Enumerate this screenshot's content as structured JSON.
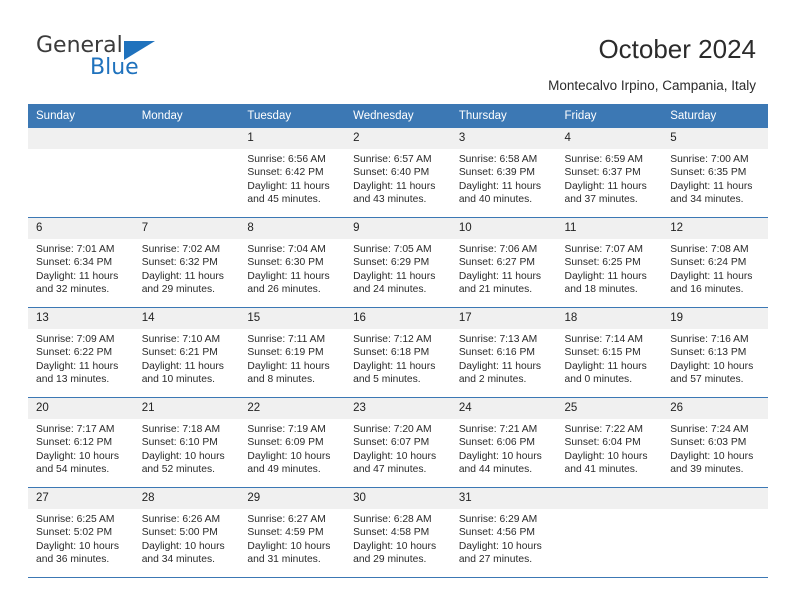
{
  "brand": {
    "word_one": "General",
    "word_two": "Blue",
    "triangle_icon": "blue-triangle-icon",
    "color_dark": "#3b3b3b",
    "color_blue": "#1f72bd"
  },
  "header": {
    "title": "October 2024",
    "subtitle": "Montecalvo Irpino, Campania, Italy"
  },
  "theme": {
    "header_bg": "#3c78b4",
    "header_text": "#ffffff",
    "daynum_bg": "#f0f0f0",
    "row_line": "#3c78b4"
  },
  "weekdays": [
    "Sunday",
    "Monday",
    "Tuesday",
    "Wednesday",
    "Thursday",
    "Friday",
    "Saturday"
  ],
  "weeks": [
    [
      {
        "day": "",
        "lines": []
      },
      {
        "day": "",
        "lines": []
      },
      {
        "day": "1",
        "lines": [
          "Sunrise: 6:56 AM",
          "Sunset: 6:42 PM",
          "Daylight: 11 hours",
          "and 45 minutes."
        ]
      },
      {
        "day": "2",
        "lines": [
          "Sunrise: 6:57 AM",
          "Sunset: 6:40 PM",
          "Daylight: 11 hours",
          "and 43 minutes."
        ]
      },
      {
        "day": "3",
        "lines": [
          "Sunrise: 6:58 AM",
          "Sunset: 6:39 PM",
          "Daylight: 11 hours",
          "and 40 minutes."
        ]
      },
      {
        "day": "4",
        "lines": [
          "Sunrise: 6:59 AM",
          "Sunset: 6:37 PM",
          "Daylight: 11 hours",
          "and 37 minutes."
        ]
      },
      {
        "day": "5",
        "lines": [
          "Sunrise: 7:00 AM",
          "Sunset: 6:35 PM",
          "Daylight: 11 hours",
          "and 34 minutes."
        ]
      }
    ],
    [
      {
        "day": "6",
        "lines": [
          "Sunrise: 7:01 AM",
          "Sunset: 6:34 PM",
          "Daylight: 11 hours",
          "and 32 minutes."
        ]
      },
      {
        "day": "7",
        "lines": [
          "Sunrise: 7:02 AM",
          "Sunset: 6:32 PM",
          "Daylight: 11 hours",
          "and 29 minutes."
        ]
      },
      {
        "day": "8",
        "lines": [
          "Sunrise: 7:04 AM",
          "Sunset: 6:30 PM",
          "Daylight: 11 hours",
          "and 26 minutes."
        ]
      },
      {
        "day": "9",
        "lines": [
          "Sunrise: 7:05 AM",
          "Sunset: 6:29 PM",
          "Daylight: 11 hours",
          "and 24 minutes."
        ]
      },
      {
        "day": "10",
        "lines": [
          "Sunrise: 7:06 AM",
          "Sunset: 6:27 PM",
          "Daylight: 11 hours",
          "and 21 minutes."
        ]
      },
      {
        "day": "11",
        "lines": [
          "Sunrise: 7:07 AM",
          "Sunset: 6:25 PM",
          "Daylight: 11 hours",
          "and 18 minutes."
        ]
      },
      {
        "day": "12",
        "lines": [
          "Sunrise: 7:08 AM",
          "Sunset: 6:24 PM",
          "Daylight: 11 hours",
          "and 16 minutes."
        ]
      }
    ],
    [
      {
        "day": "13",
        "lines": [
          "Sunrise: 7:09 AM",
          "Sunset: 6:22 PM",
          "Daylight: 11 hours",
          "and 13 minutes."
        ]
      },
      {
        "day": "14",
        "lines": [
          "Sunrise: 7:10 AM",
          "Sunset: 6:21 PM",
          "Daylight: 11 hours",
          "and 10 minutes."
        ]
      },
      {
        "day": "15",
        "lines": [
          "Sunrise: 7:11 AM",
          "Sunset: 6:19 PM",
          "Daylight: 11 hours",
          "and 8 minutes."
        ]
      },
      {
        "day": "16",
        "lines": [
          "Sunrise: 7:12 AM",
          "Sunset: 6:18 PM",
          "Daylight: 11 hours",
          "and 5 minutes."
        ]
      },
      {
        "day": "17",
        "lines": [
          "Sunrise: 7:13 AM",
          "Sunset: 6:16 PM",
          "Daylight: 11 hours",
          "and 2 minutes."
        ]
      },
      {
        "day": "18",
        "lines": [
          "Sunrise: 7:14 AM",
          "Sunset: 6:15 PM",
          "Daylight: 11 hours",
          "and 0 minutes."
        ]
      },
      {
        "day": "19",
        "lines": [
          "Sunrise: 7:16 AM",
          "Sunset: 6:13 PM",
          "Daylight: 10 hours",
          "and 57 minutes."
        ]
      }
    ],
    [
      {
        "day": "20",
        "lines": [
          "Sunrise: 7:17 AM",
          "Sunset: 6:12 PM",
          "Daylight: 10 hours",
          "and 54 minutes."
        ]
      },
      {
        "day": "21",
        "lines": [
          "Sunrise: 7:18 AM",
          "Sunset: 6:10 PM",
          "Daylight: 10 hours",
          "and 52 minutes."
        ]
      },
      {
        "day": "22",
        "lines": [
          "Sunrise: 7:19 AM",
          "Sunset: 6:09 PM",
          "Daylight: 10 hours",
          "and 49 minutes."
        ]
      },
      {
        "day": "23",
        "lines": [
          "Sunrise: 7:20 AM",
          "Sunset: 6:07 PM",
          "Daylight: 10 hours",
          "and 47 minutes."
        ]
      },
      {
        "day": "24",
        "lines": [
          "Sunrise: 7:21 AM",
          "Sunset: 6:06 PM",
          "Daylight: 10 hours",
          "and 44 minutes."
        ]
      },
      {
        "day": "25",
        "lines": [
          "Sunrise: 7:22 AM",
          "Sunset: 6:04 PM",
          "Daylight: 10 hours",
          "and 41 minutes."
        ]
      },
      {
        "day": "26",
        "lines": [
          "Sunrise: 7:24 AM",
          "Sunset: 6:03 PM",
          "Daylight: 10 hours",
          "and 39 minutes."
        ]
      }
    ],
    [
      {
        "day": "27",
        "lines": [
          "Sunrise: 6:25 AM",
          "Sunset: 5:02 PM",
          "Daylight: 10 hours",
          "and 36 minutes."
        ]
      },
      {
        "day": "28",
        "lines": [
          "Sunrise: 6:26 AM",
          "Sunset: 5:00 PM",
          "Daylight: 10 hours",
          "and 34 minutes."
        ]
      },
      {
        "day": "29",
        "lines": [
          "Sunrise: 6:27 AM",
          "Sunset: 4:59 PM",
          "Daylight: 10 hours",
          "and 31 minutes."
        ]
      },
      {
        "day": "30",
        "lines": [
          "Sunrise: 6:28 AM",
          "Sunset: 4:58 PM",
          "Daylight: 10 hours",
          "and 29 minutes."
        ]
      },
      {
        "day": "31",
        "lines": [
          "Sunrise: 6:29 AM",
          "Sunset: 4:56 PM",
          "Daylight: 10 hours",
          "and 27 minutes."
        ]
      },
      {
        "day": "",
        "lines": []
      },
      {
        "day": "",
        "lines": []
      }
    ]
  ]
}
